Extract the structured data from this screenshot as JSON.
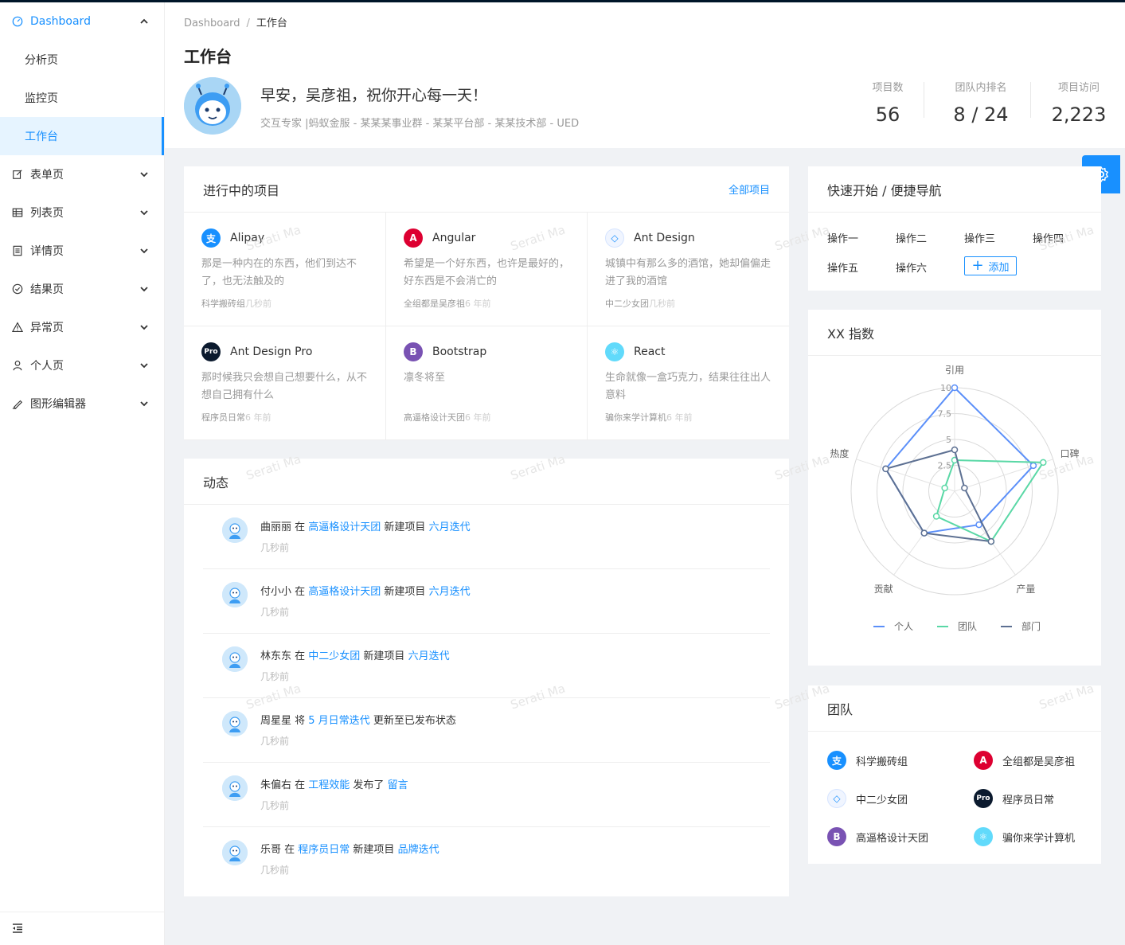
{
  "sidebar": {
    "items": [
      {
        "label": "Dashboard",
        "icon": "dashboard-icon",
        "expanded": true
      },
      {
        "label": "分析页"
      },
      {
        "label": "监控页"
      },
      {
        "label": "工作台",
        "active": true
      },
      {
        "label": "表单页",
        "icon": "form-icon"
      },
      {
        "label": "列表页",
        "icon": "table-icon"
      },
      {
        "label": "详情页",
        "icon": "profile-icon"
      },
      {
        "label": "结果页",
        "icon": "check-circle-icon"
      },
      {
        "label": "异常页",
        "icon": "warning-icon"
      },
      {
        "label": "个人页",
        "icon": "user-icon"
      },
      {
        "label": "图形编辑器",
        "icon": "highlight-icon"
      }
    ]
  },
  "header": {
    "breadcrumb": [
      "Dashboard",
      "工作台"
    ],
    "breadcrumb_sep": "/",
    "title": "工作台",
    "greeting": "早安，吴彦祖，祝你开心每一天！",
    "subinfo": "交互专家 |蚂蚁金服 - 某某某事业群 - 某某平台部 - 某某技术部 - UED",
    "stats": [
      {
        "label": "项目数",
        "value": "56"
      },
      {
        "label": "团队内排名",
        "value": "8 / 24"
      },
      {
        "label": "项目访问",
        "value": "2,223"
      }
    ]
  },
  "projects": {
    "title": "进行中的项目",
    "extra": "全部项目",
    "items": [
      {
        "name": "Alipay",
        "desc": "那是一种内在的东西，他们到达不了，也无法触及的",
        "member": "科学搬砖组",
        "time": "几秒前",
        "color": "#1890ff",
        "glyph": "支"
      },
      {
        "name": "Angular",
        "desc": "希望是一个好东西，也许是最好的，好东西是不会消亡的",
        "member": "全组都是吴彦祖",
        "time": "6 年前",
        "color": "#dd0031",
        "glyph": "A"
      },
      {
        "name": "Ant Design",
        "desc": "城镇中有那么多的酒馆，她却偏偏走进了我的酒馆",
        "member": "中二少女团",
        "time": "几秒前",
        "color": "#f0f5ff",
        "glyph": "◇"
      },
      {
        "name": "Ant Design Pro",
        "desc": "那时候我只会想自己想要什么，从不想自己拥有什么",
        "member": "程序员日常",
        "time": "6 年前",
        "color": "#0b1a2e",
        "glyph": "Pro"
      },
      {
        "name": "Bootstrap",
        "desc": "凛冬将至",
        "member": "高逼格设计天团",
        "time": "6 年前",
        "color": "#7952b3",
        "glyph": "B"
      },
      {
        "name": "React",
        "desc": "生命就像一盒巧克力，结果往往出人意料",
        "member": "骗你来学计算机",
        "time": "6 年前",
        "color": "#61dafb",
        "glyph": "⚛"
      }
    ]
  },
  "activities": {
    "title": "动态",
    "items": [
      {
        "user": "曲丽丽",
        "w1": " 在 ",
        "group": "高逼格设计天团",
        "w2": " 新建项目 ",
        "project": "六月迭代",
        "time": "几秒前"
      },
      {
        "user": "付小小",
        "w1": " 在 ",
        "group": "高逼格设计天团",
        "w2": " 新建项目 ",
        "project": "六月迭代",
        "time": "几秒前"
      },
      {
        "user": "林东东",
        "w1": " 在 ",
        "group": "中二少女团",
        "w2": " 新建项目 ",
        "project": "六月迭代",
        "time": "几秒前"
      },
      {
        "user": "周星星",
        "w1": " 将 ",
        "group": "5 月日常迭代",
        "w2": " 更新至已发布状态",
        "project": "",
        "time": "几秒前"
      },
      {
        "user": "朱偏右",
        "w1": " 在 ",
        "group": "工程效能",
        "w2": " 发布了 ",
        "project": "留言",
        "time": "几秒前"
      },
      {
        "user": "乐哥",
        "w1": " 在 ",
        "group": "程序员日常",
        "w2": " 新建项目 ",
        "project": "品牌迭代",
        "time": "几秒前"
      }
    ]
  },
  "quick": {
    "title": "快速开始 / 便捷导航",
    "links": [
      "操作一",
      "操作二",
      "操作三",
      "操作四",
      "操作五",
      "操作六"
    ],
    "add_label": "添加"
  },
  "radar": {
    "title": "XX 指数",
    "legend": [
      "个人",
      "团队",
      "部门"
    ],
    "colors": [
      "#5b8ff9",
      "#5ad8a6",
      "#5d7092"
    ]
  },
  "chart_data": {
    "type": "radar",
    "title": "XX 指数",
    "categories": [
      "引用",
      "口碑",
      "产量",
      "贡献",
      "热度"
    ],
    "ticks": [
      "2.5",
      "5",
      "7.5",
      "10"
    ],
    "range": [
      0,
      10
    ],
    "series": [
      {
        "name": "个人",
        "values": [
          10,
          8,
          4,
          5,
          7
        ]
      },
      {
        "name": "团队",
        "values": [
          3,
          9,
          6,
          3,
          1
        ]
      },
      {
        "name": "部门",
        "values": [
          4,
          1,
          6,
          5,
          7
        ]
      }
    ]
  },
  "team": {
    "title": "团队",
    "items": [
      {
        "name": "科学搬砖组",
        "color": "#1890ff",
        "glyph": "支"
      },
      {
        "name": "全组都是吴彦祖",
        "color": "#dd0031",
        "glyph": "A"
      },
      {
        "name": "中二少女团",
        "color": "#f0f5ff",
        "glyph": "◇"
      },
      {
        "name": "程序员日常",
        "color": "#0b1a2e",
        "glyph": "Pro"
      },
      {
        "name": "高逼格设计天团",
        "color": "#7952b3",
        "glyph": "B"
      },
      {
        "name": "骗你来学计算机",
        "color": "#61dafb",
        "glyph": "⚛"
      }
    ]
  },
  "watermark": "Serati Ma"
}
